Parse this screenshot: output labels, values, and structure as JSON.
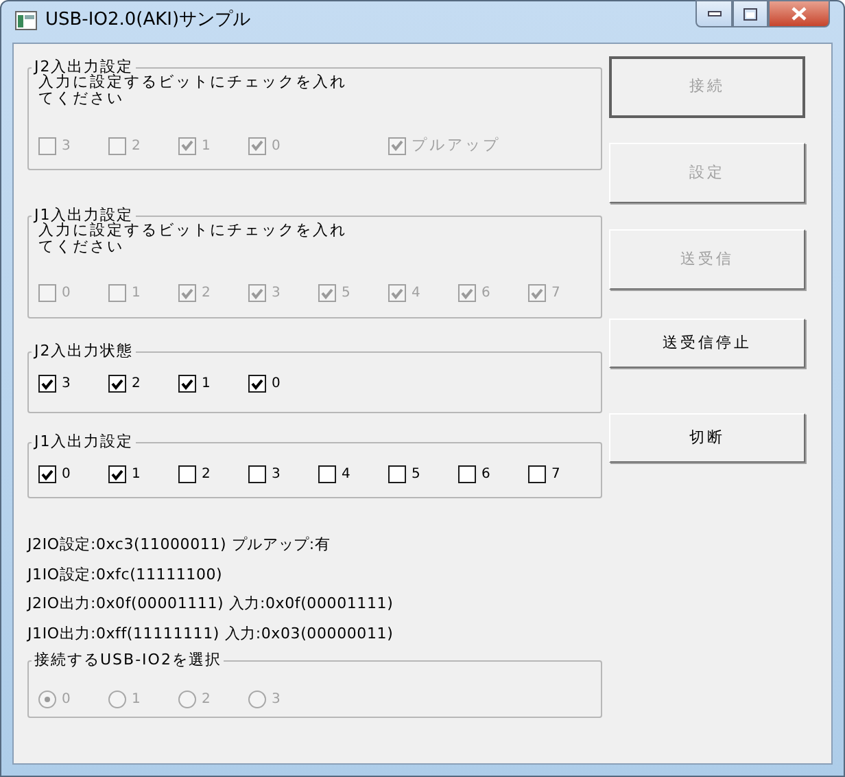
{
  "window": {
    "title": "USB-IO2.0(AKI)サンプル"
  },
  "groups": [
    {
      "title": "J2入出力設定",
      "kind": "checkbox",
      "description": "入力に設定するビットにチェックを入れてください",
      "options": [
        {
          "label": "3",
          "checked": false,
          "disabled": true
        },
        {
          "label": "2",
          "checked": false,
          "disabled": true
        },
        {
          "label": "1",
          "checked": true,
          "disabled": true
        },
        {
          "label": "0",
          "checked": true,
          "disabled": true
        },
        {
          "label": "プルアップ",
          "checked": true,
          "disabled": true,
          "kind": "pullup"
        }
      ]
    },
    {
      "title": "J1入出力設定",
      "kind": "checkbox",
      "description": "入力に設定するビットにチェックを入れてください",
      "options": [
        {
          "label": "0",
          "checked": false,
          "disabled": true
        },
        {
          "label": "1",
          "checked": false,
          "disabled": true
        },
        {
          "label": "2",
          "checked": true,
          "disabled": true
        },
        {
          "label": "3",
          "checked": true,
          "disabled": true
        },
        {
          "label": "5",
          "checked": true,
          "disabled": true
        },
        {
          "label": "4",
          "checked": true,
          "disabled": true
        },
        {
          "label": "6",
          "checked": true,
          "disabled": true
        },
        {
          "label": "7",
          "checked": true,
          "disabled": true
        }
      ]
    },
    {
      "title": "J2入出力状態",
      "kind": "checkbox",
      "options": [
        {
          "label": "3",
          "checked": true,
          "disabled": false
        },
        {
          "label": "2",
          "checked": true,
          "disabled": false
        },
        {
          "label": "1",
          "checked": true,
          "disabled": false
        },
        {
          "label": "0",
          "checked": true,
          "disabled": false
        }
      ]
    },
    {
      "title": "J1入出力設定",
      "kind": "checkbox",
      "options": [
        {
          "label": "0",
          "checked": true,
          "disabled": false
        },
        {
          "label": "1",
          "checked": true,
          "disabled": false
        },
        {
          "label": "2",
          "checked": false,
          "disabled": false
        },
        {
          "label": "3",
          "checked": false,
          "disabled": false
        },
        {
          "label": "4",
          "checked": false,
          "disabled": false
        },
        {
          "label": "5",
          "checked": false,
          "disabled": false
        },
        {
          "label": "6",
          "checked": false,
          "disabled": false
        },
        {
          "label": "7",
          "checked": false,
          "disabled": false
        }
      ]
    }
  ],
  "status_lines": [
    "J2IO設定:0xc3(11000011) プルアップ:有",
    "J1IO設定:0xfc(11111100)",
    "J2IO出力:0x0f(00001111) 入力:0x0f(00001111)",
    "J1IO出力:0xff(11111111) 入力:0x03(00000011)"
  ],
  "device_group": {
    "title": "接続するUSB-IO2を選択",
    "kind": "radio",
    "options": [
      {
        "label": "0",
        "selected": true,
        "disabled": true
      },
      {
        "label": "1",
        "selected": false,
        "disabled": true
      },
      {
        "label": "2",
        "selected": false,
        "disabled": true
      },
      {
        "label": "3",
        "selected": false,
        "disabled": true
      }
    ]
  },
  "buttons": [
    {
      "label": "接続",
      "disabled": true,
      "default": true
    },
    {
      "label": "設定",
      "disabled": true,
      "default": false
    },
    {
      "label": "送受信",
      "disabled": true,
      "default": false
    },
    {
      "label": "送受信停止",
      "disabled": false,
      "default": false
    },
    {
      "label": "切断",
      "disabled": false,
      "default": false
    }
  ]
}
